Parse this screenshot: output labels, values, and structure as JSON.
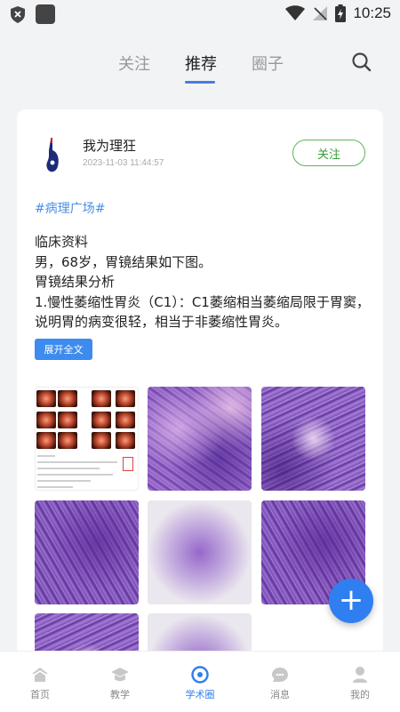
{
  "status_bar": {
    "time": "10:25"
  },
  "top_tabs": [
    {
      "label": "关注",
      "active": false
    },
    {
      "label": "推荐",
      "active": true
    },
    {
      "label": "圈子",
      "active": false
    }
  ],
  "post": {
    "author": "我为理狂",
    "date": "2023-11-03 11:44:57",
    "follow_label": "关注",
    "hashtag": "#病理广场#",
    "lines": [
      "临床资料",
      "男，68岁，胃镜结果如下图。",
      "胃镜结果分析",
      "1.慢性萎缩性胃炎（C1）：C1萎缩相当萎缩局限于胃窦，说明胃的病变很轻，相当于非萎缩性胃炎。"
    ],
    "expand_label": "展开全文"
  },
  "fab_label": "+",
  "bottom_nav": [
    {
      "label": "首页",
      "icon": "home-icon",
      "active": false
    },
    {
      "label": "教学",
      "icon": "graduation-cap-icon",
      "active": false
    },
    {
      "label": "学术圈",
      "icon": "compass-icon",
      "active": true
    },
    {
      "label": "消息",
      "icon": "message-icon",
      "active": false
    },
    {
      "label": "我的",
      "icon": "profile-icon",
      "active": false
    }
  ],
  "colors": {
    "accent": "#2f7ff0",
    "follow_green": "#5cb35c",
    "hashtag_blue": "#4a8fe6"
  }
}
